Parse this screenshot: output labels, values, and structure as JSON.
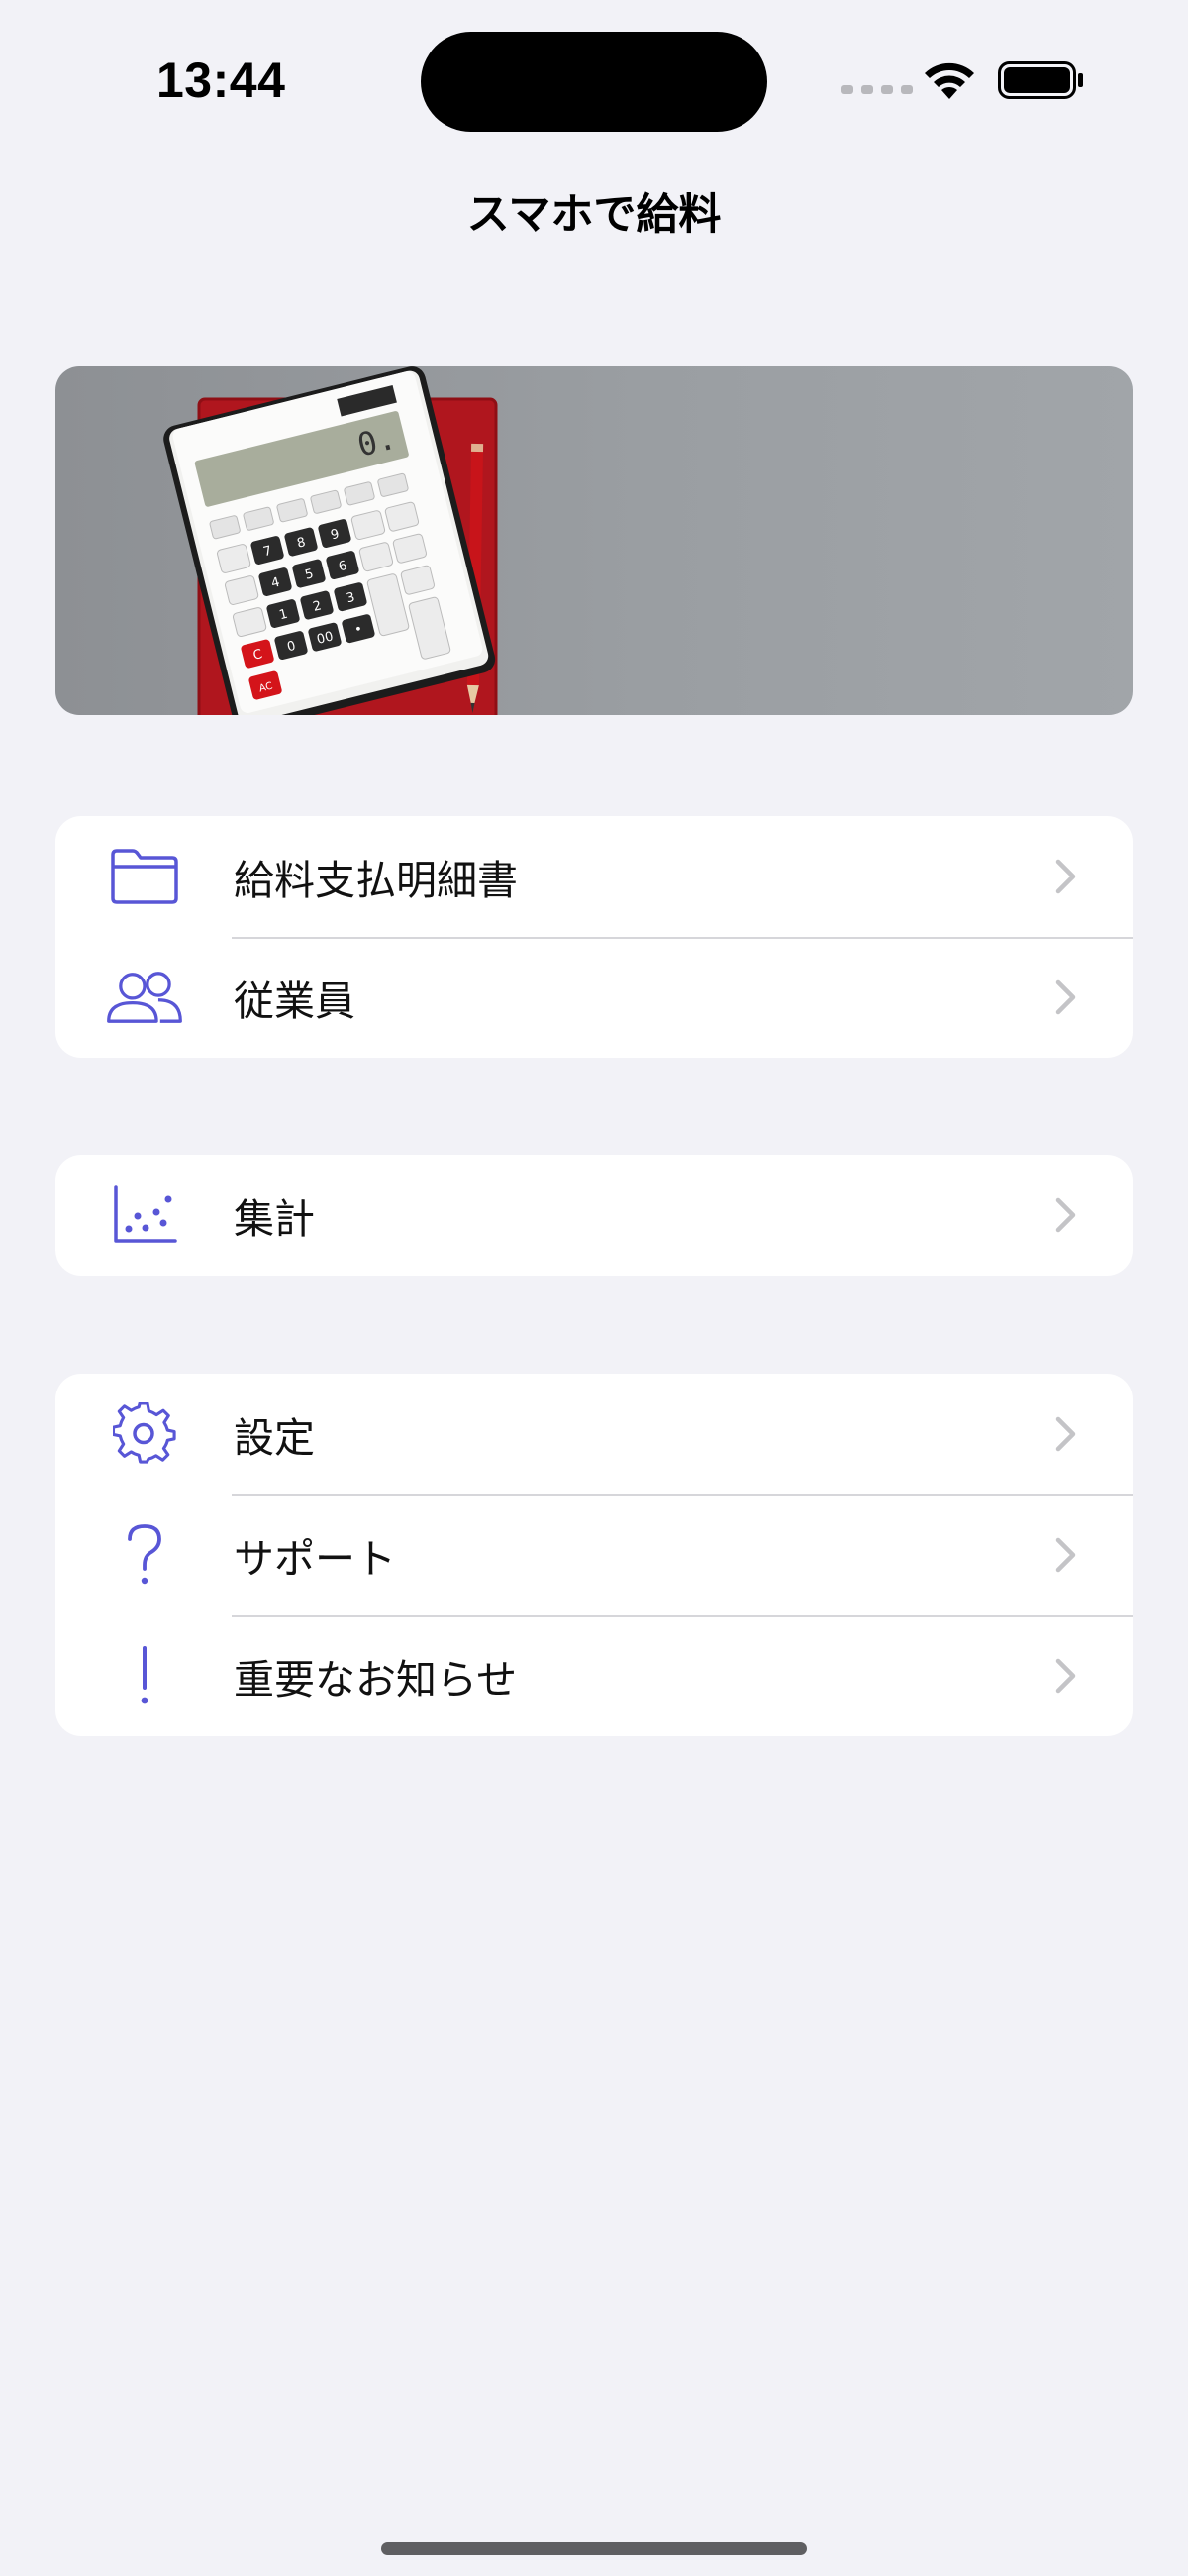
{
  "status_bar": {
    "time": "13:44"
  },
  "nav": {
    "title": "スマホで給料"
  },
  "colors": {
    "accent": "#5856d6",
    "background": "#f2f2f7",
    "chevron": "#c4c4c7"
  },
  "menu": {
    "group1": [
      {
        "label": "給料支払明細書",
        "icon": "folder-icon"
      },
      {
        "label": "従業員",
        "icon": "people-icon"
      }
    ],
    "group2": [
      {
        "label": "集計",
        "icon": "scatter-chart-icon"
      }
    ],
    "group3": [
      {
        "label": "設定",
        "icon": "gear-icon"
      },
      {
        "label": "サポート",
        "icon": "question-mark-icon"
      },
      {
        "label": "重要なお知らせ",
        "icon": "exclamation-mark-icon"
      }
    ]
  }
}
